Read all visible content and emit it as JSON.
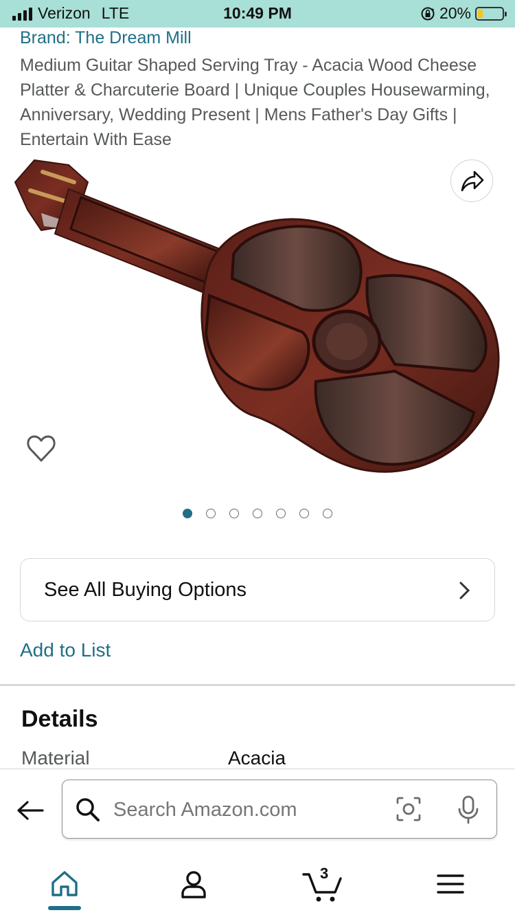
{
  "status_bar": {
    "carrier": "Verizon",
    "network": "LTE",
    "time": "10:49 PM",
    "battery": "20%",
    "battery_level": 0.2
  },
  "product": {
    "brand": "Brand: The Dream Mill",
    "title": "Medium Guitar Shaped Serving Tray - Acacia Wood Cheese Platter & Charcuterie Board | Unique Couples Housewarming, Anniversary, Wedding Present | Mens Father's Day Gifts | Entertain With Ease",
    "image_icon": "guitar-tray-image",
    "image_count": 7,
    "active_image_index": 0
  },
  "actions": {
    "buying_options_label": "See All Buying Options",
    "add_to_list_label": "Add to List"
  },
  "details": {
    "heading": "Details",
    "rows": [
      {
        "label": "Material",
        "value": "Acacia"
      }
    ]
  },
  "search": {
    "placeholder": "Search Amazon.com",
    "value": ""
  },
  "tabbar": {
    "items": [
      {
        "name": "home",
        "icon": "home-icon",
        "active": true
      },
      {
        "name": "account",
        "icon": "person-icon",
        "active": false
      },
      {
        "name": "cart",
        "icon": "cart-icon",
        "active": false
      },
      {
        "name": "menu",
        "icon": "menu-icon",
        "active": false
      }
    ],
    "cart_count": "3"
  },
  "colors": {
    "status_bar_bg": "#a8dfd6",
    "link": "#1f6f86",
    "text_secondary": "#565959"
  }
}
